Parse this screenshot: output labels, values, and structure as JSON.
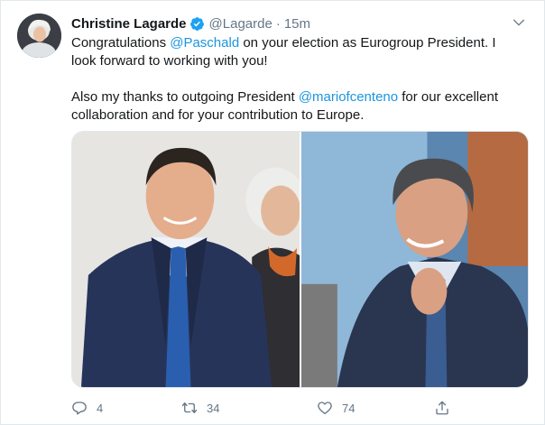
{
  "author": {
    "name": "Christine Lagarde",
    "handle": "@Lagarde",
    "separator": "·",
    "time": "15m",
    "verified": true
  },
  "tweet": {
    "line1_prefix": "Congratulations ",
    "mention1": "@Paschald",
    "line1_suffix": " on your election as Eurogroup President. I look forward to working with you!",
    "line2_prefix": "Also my thanks to outgoing President ",
    "mention2": "@mariofcenteno",
    "line2_suffix": " for our excellent collaboration and for your contribution to Europe."
  },
  "actions": {
    "replies": "4",
    "retweets": "34",
    "likes": "74"
  },
  "colors": {
    "link": "#1b95e0",
    "muted": "#657786",
    "verified": "#1da1f2"
  },
  "icons": {
    "reply": "comment-bubble-icon",
    "retweet": "retweet-arrows-icon",
    "like": "heart-outline-icon",
    "share": "share-upload-icon",
    "more": "chevron-down-icon",
    "verified": "verified-badge-icon"
  }
}
